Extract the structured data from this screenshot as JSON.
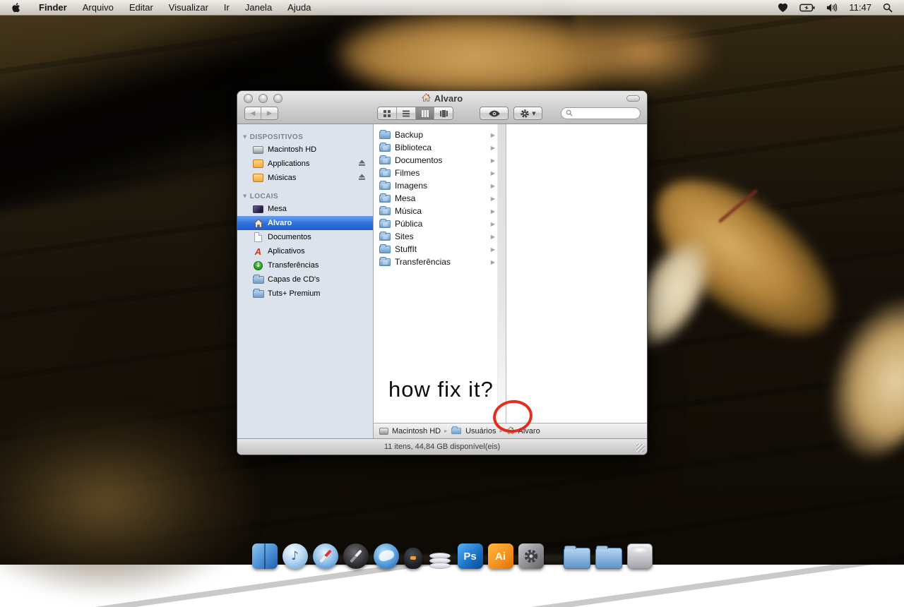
{
  "colors": {
    "selection_blue": "#2f6ddb",
    "annotation_red": "#e11b0e",
    "sidebar_bg": "#dce3ec"
  },
  "menu_bar": {
    "apple_icon": "apple-logo",
    "items": [
      {
        "label": "Finder"
      },
      {
        "label": "Arquivo"
      },
      {
        "label": "Editar"
      },
      {
        "label": "Visualizar"
      },
      {
        "label": "Ir"
      },
      {
        "label": "Janela"
      },
      {
        "label": "Ajuda"
      }
    ],
    "status_icons": [
      "heart-icon",
      "battery-icon",
      "volume-icon",
      "spotlight-icon"
    ],
    "time": "11:47"
  },
  "window": {
    "title": "Alvaro",
    "title_icon": "home-icon",
    "toolbar": {
      "view_modes": [
        "icon-view",
        "list-view",
        "column-view",
        "coverflow-view"
      ],
      "selected_view": "column-view",
      "quicklook_icon": "eye-icon",
      "action_icon": "gear-icon",
      "search_placeholder": ""
    }
  },
  "sidebar": {
    "sections": [
      {
        "header": "DISPOSITIVOS"
      },
      {
        "header": "LOCAIS"
      }
    ],
    "devices": [
      {
        "label": "Macintosh HD",
        "icon": "hard-drive-icon",
        "eject": false
      },
      {
        "label": "Applications",
        "icon": "orange-disk-icon",
        "eject": true
      },
      {
        "label": "Músicas",
        "icon": "orange-disk-icon",
        "eject": true
      }
    ],
    "places": [
      {
        "label": "Mesa",
        "icon": "desktop-icon",
        "selected": false
      },
      {
        "label": "Alvaro",
        "icon": "home-icon",
        "selected": true
      },
      {
        "label": "Documentos",
        "icon": "document-icon",
        "selected": false
      },
      {
        "label": "Aplicativos",
        "icon": "applications-icon",
        "selected": false
      },
      {
        "label": "Transferências",
        "icon": "downloads-icon",
        "selected": false
      },
      {
        "label": "Capas de CD's",
        "icon": "folder-icon",
        "selected": false
      },
      {
        "label": "Tuts+ Premium",
        "icon": "folder-icon",
        "selected": false
      }
    ],
    "aplicativos_glyph": "A",
    "downloads_glyph": "↓"
  },
  "browser": {
    "folders": [
      {
        "name": "Backup"
      },
      {
        "name": "Biblioteca"
      },
      {
        "name": "Documentos"
      },
      {
        "name": "Filmes"
      },
      {
        "name": "Imagens"
      },
      {
        "name": "Mesa"
      },
      {
        "name": "Música"
      },
      {
        "name": "Pública"
      },
      {
        "name": "Sites"
      },
      {
        "name": "StuffIt"
      },
      {
        "name": "Transferências"
      }
    ],
    "row_arrow": "▶"
  },
  "path_bar": {
    "segments": [
      {
        "label": "Macintosh HD",
        "icon": "hard-drive-icon"
      },
      {
        "label": "Usuários",
        "icon": "folder-icon"
      },
      {
        "label": "Alvaro",
        "icon": "home-icon"
      }
    ],
    "separator": "▸"
  },
  "status_bar": {
    "text": "11 itens, 44,84 GB disponível(eis)"
  },
  "annotation": {
    "text": "how fix it?"
  },
  "dock": {
    "items": [
      "finder",
      "itunes",
      "safari",
      "dark-compass-app",
      "thunderbird",
      "bird-app",
      "stacks-app",
      "photoshop",
      "illustrator",
      "system-preferences",
      "applications-folder",
      "documents-folder",
      "trash"
    ],
    "itunes_glyph": "♪",
    "photoshop_glyph": "Ps",
    "illustrator_glyph": "Ai"
  }
}
